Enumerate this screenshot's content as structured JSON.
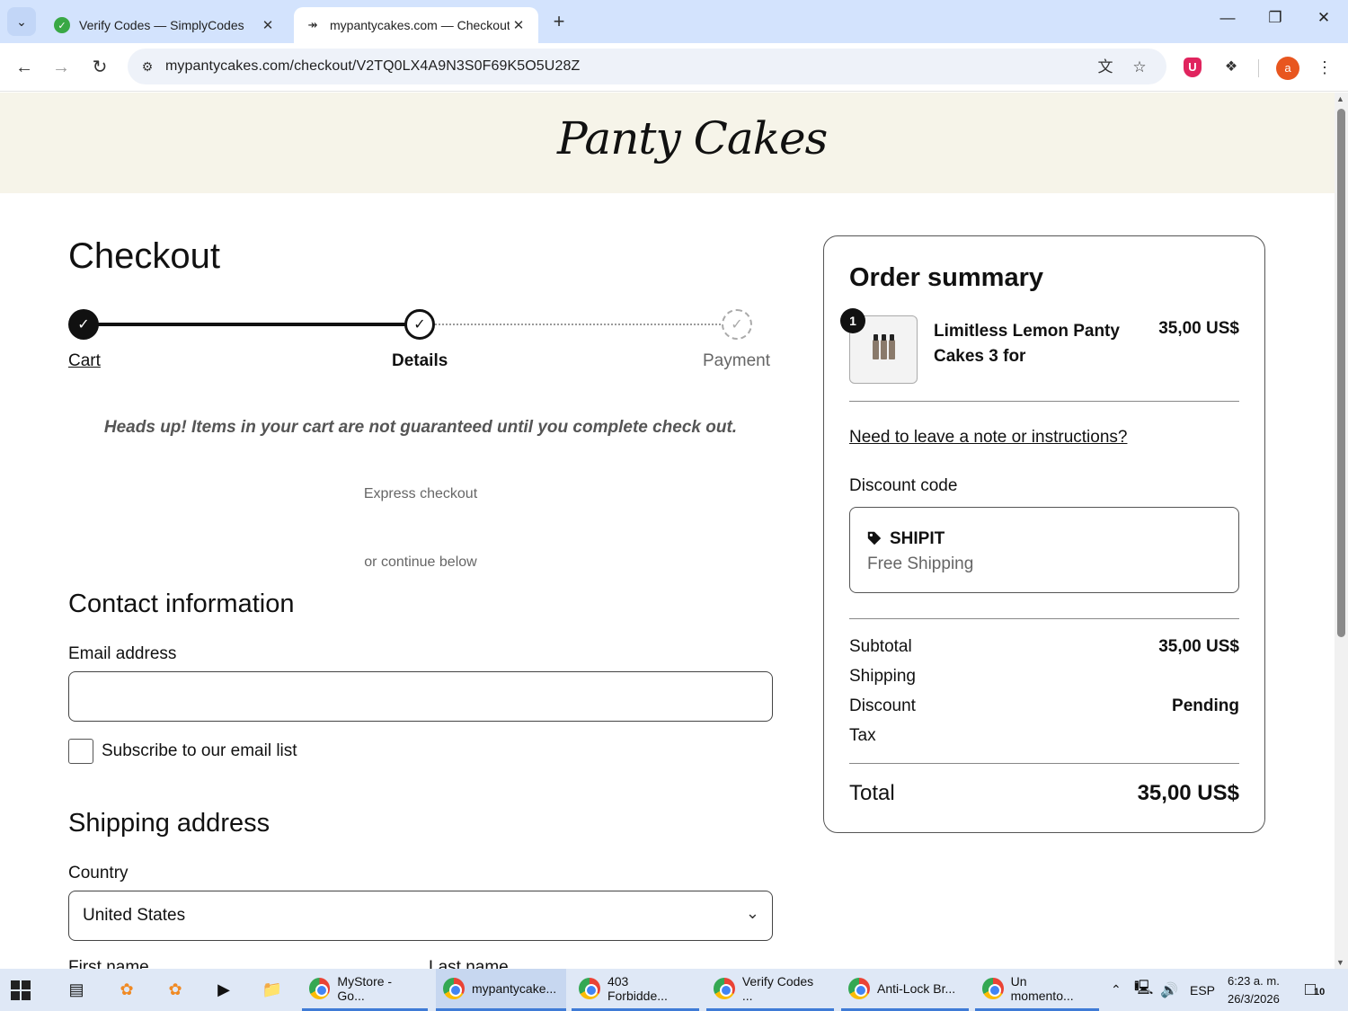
{
  "browser": {
    "tabs": [
      {
        "title": "Verify Codes — SimplyCodes",
        "active": false
      },
      {
        "title": "mypantycakes.com — Checkout",
        "active": true
      }
    ],
    "url": "mypantycakes.com/checkout/V2TQ0LX4A9N3S0F69K5O5U28Z",
    "profile_initial": "a"
  },
  "page": {
    "brand": "Panty Cakes",
    "heading": "Checkout",
    "steps": [
      {
        "label": "Cart",
        "state": "done"
      },
      {
        "label": "Details",
        "state": "current"
      },
      {
        "label": "Payment",
        "state": "todo"
      }
    ],
    "headsup": "Heads up! Items in your cart are not guaranteed until you complete check out.",
    "express_checkout": "Express checkout",
    "continue_below": "or continue below",
    "contact": {
      "heading": "Contact information",
      "email_label": "Email address",
      "email_value": "",
      "subscribe_label": "Subscribe to our email list",
      "subscribe_checked": false
    },
    "shipping": {
      "heading": "Shipping address",
      "country_label": "Country",
      "country_value": "United States",
      "first_name_label": "First name",
      "last_name_label": "Last name"
    }
  },
  "summary": {
    "title": "Order summary",
    "item": {
      "quantity": "1",
      "name": "Limitless Lemon Panty Cakes 3 for",
      "price": "35,00 US$"
    },
    "note_link": "Need to leave a note or instructions?",
    "discount_label": "Discount code",
    "discount_code": "SHIPIT",
    "discount_desc": "Free Shipping",
    "rows": {
      "subtotal_label": "Subtotal",
      "subtotal_value": "35,00 US$",
      "shipping_label": "Shipping",
      "shipping_value": "",
      "discount_label": "Discount",
      "discount_value": "Pending",
      "tax_label": "Tax",
      "tax_value": ""
    },
    "total_label": "Total",
    "total_value": "35,00 US$"
  },
  "taskbar": {
    "apps": [
      {
        "label": "MyStore - Go..."
      },
      {
        "label": "mypantycake..."
      },
      {
        "label": "403 Forbidde..."
      },
      {
        "label": "Verify Codes ..."
      },
      {
        "label": "Anti-Lock Br..."
      },
      {
        "label": "Un momento..."
      }
    ],
    "language": "ESP",
    "time": "6:23 a. m.",
    "date": "26/3/2026",
    "notifications": "10"
  },
  "colors": {
    "banner_bg": "#f6f4e9",
    "tabbar_bg": "#d3e3fd",
    "taskbar_bg": "#dfe8f6",
    "profile_avatar": "#e8561f"
  }
}
